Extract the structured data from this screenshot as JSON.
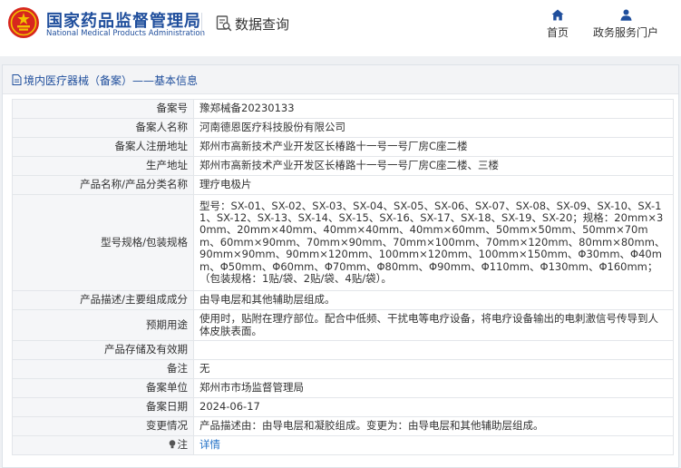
{
  "header": {
    "site_title_cn": "国家药品监督管理局",
    "site_title_en": "National Medical Products Administration",
    "section_label": "数据查询",
    "nav": {
      "home": "首页",
      "service": "政务服务门户"
    }
  },
  "breadcrumb": "境内医疗器械（备案）——基本信息",
  "rows": [
    {
      "label": "备案号",
      "value": "豫郑械备20230133"
    },
    {
      "label": "备案人名称",
      "value": "河南德恩医疗科技股份有限公司"
    },
    {
      "label": "备案人注册地址",
      "value": "郑州市高新技术产业开发区长椿路十一号一号厂房C座二楼"
    },
    {
      "label": "生产地址",
      "value": "郑州市高新技术产业开发区长椿路十一号一号厂房C座二楼、三楼"
    },
    {
      "label": "产品名称/产品分类名称",
      "value": "理疗电极片"
    },
    {
      "label": "型号规格/包装规格",
      "value": "型号：SX-01、SX-02、SX-03、SX-04、SX-05、SX-06、SX-07、SX-08、SX-09、SX-10、SX-11、SX-12、SX-13、SX-14、SX-15、SX-16、SX-17、SX-18、SX-19、SX-20；规格：20mm×30mm、20mm×40mm、40mm×40mm、40mm×60mm、50mm×50mm、50mm×70mm、60mm×90mm、70mm×90mm、70mm×100mm、70mm×120mm、80mm×80mm、90mm×90mm、90mm×120mm、100mm×120mm、100mm×150mm、Φ30mm、Φ40mm、Φ50mm、Φ60mm、Φ70mm、Φ80mm、Φ90mm、Φ110mm、Φ130mm、Φ160mm；（包装规格：1贴/袋、2贴/袋、4贴/袋）。"
    },
    {
      "label": "产品描述/主要组成成分",
      "value": "由导电层和其他辅助层组成。"
    },
    {
      "label": "预期用途",
      "value": "使用时，贴附在理疗部位。配合中低频、干扰电等电疗设备，将电疗设备输出的电刺激信号传导到人体皮肤表面。"
    },
    {
      "label": "产品存储及有效期",
      "value": ""
    },
    {
      "label": "备注",
      "value": "无"
    },
    {
      "label": "备案单位",
      "value": "郑州市市场监督管理局"
    },
    {
      "label": "备案日期",
      "value": "2024-06-17"
    },
    {
      "label": "变更情况",
      "value": "产品描述由：由导电层和凝胶组成。变更为：由导电层和其他辅助层组成。"
    }
  ],
  "note_row": {
    "label": "注",
    "link": "详情"
  },
  "icons": {
    "emblem": "national-emblem-icon",
    "query": "data-query-icon",
    "home": "home-icon",
    "service": "user-icon",
    "breadcrumb": "document-icon",
    "note": "bulb-icon"
  },
  "colors": {
    "brand_blue": "#1f4e9c",
    "link_blue": "#1f6fc6",
    "emblem_red": "#d7261e",
    "emblem_gold": "#f2c200"
  }
}
